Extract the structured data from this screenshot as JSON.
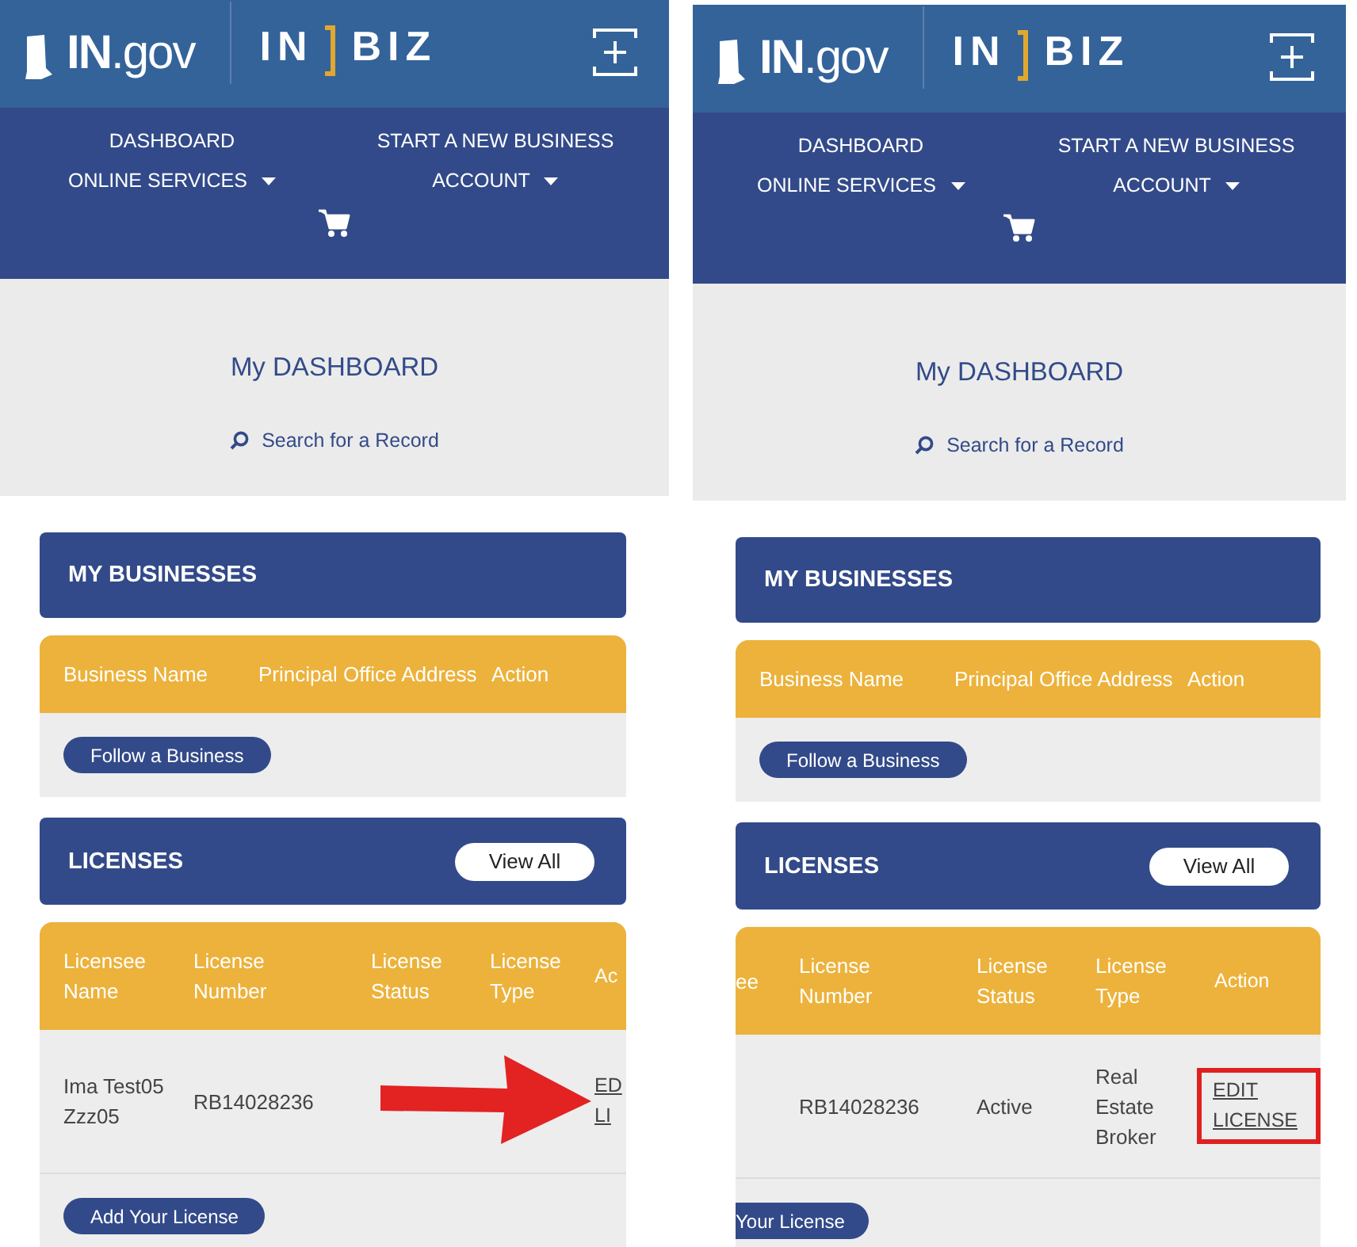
{
  "panels": [
    {
      "scrolled": false,
      "arrow": true,
      "header": {
        "logo_text": "**IN**.gov",
        "brand_left": "IN",
        "brand_right": "BIZ"
      },
      "nav": [
        {
          "label": "DASHBOARD",
          "dropdown": false
        },
        {
          "label": "START A NEW BUSINESS",
          "dropdown": false
        },
        {
          "label": "ONLINE SERVICES",
          "dropdown": true
        },
        {
          "label": "ACCOUNT",
          "dropdown": true
        }
      ],
      "page_title": "My DASHBOARD",
      "search_link": "Search for a Record",
      "businesses": {
        "title": "MY BUSINESSES",
        "columns": [
          "Business Name",
          "Principal Office Address",
          "Action"
        ],
        "button": "Follow a Business"
      },
      "licenses": {
        "title": "LICENSES",
        "view_all": "View All",
        "columns": [
          "Licensee Name",
          "License Number",
          "License Status",
          "License Type",
          "Ac"
        ],
        "rows": [
          {
            "name": "Ima Test05 Zzz05",
            "number": "RB14028236",
            "action": "ED LI",
            "highlighted": false
          }
        ],
        "button": "Add Your License"
      }
    },
    {
      "scrolled": true,
      "arrow": false,
      "header": {
        "logo_text": "**IN**.gov",
        "brand_left": "IN",
        "brand_right": "BIZ"
      },
      "nav": [
        {
          "label": "DASHBOARD",
          "dropdown": false
        },
        {
          "label": "START A NEW BUSINESS",
          "dropdown": false
        },
        {
          "label": "ONLINE SERVICES",
          "dropdown": true
        },
        {
          "label": "ACCOUNT",
          "dropdown": true
        }
      ],
      "page_title": "My DASHBOARD",
      "search_link": "Search for a Record",
      "businesses": {
        "title": "MY BUSINESSES",
        "columns": [
          "Business Name",
          "Principal Office Address",
          "Action"
        ],
        "button": "Follow a Business"
      },
      "licenses": {
        "title": "LICENSES",
        "view_all": "View All",
        "columns": [
          "ee",
          "License Number",
          "License Status",
          "License Type",
          "Action"
        ],
        "rows": [
          {
            "number": "RB14028236",
            "status": "Active",
            "type": "Real Estate Broker",
            "action": "EDIT LICENSE",
            "highlighted": true
          }
        ],
        "button": "Your License"
      }
    }
  ]
}
